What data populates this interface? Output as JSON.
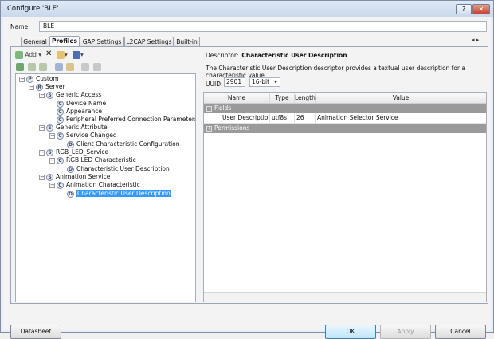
{
  "window": {
    "title": "Configure 'BLE'",
    "help_glyph": "?",
    "close_glyph": "✕"
  },
  "name_field": {
    "label": "Name:",
    "value": "BLE"
  },
  "tabs": [
    {
      "label": "General"
    },
    {
      "label": "Profiles"
    },
    {
      "label": "GAP Settings"
    },
    {
      "label": "L2CAP Settings"
    },
    {
      "label": "Built-in"
    }
  ],
  "tab_scroll": {
    "glyph": "◂ ▸"
  },
  "toolbar": {
    "add_label": "Add",
    "add_icon": "add-icon",
    "delete_glyph": "✕",
    "folder_glyph": "▾",
    "save_glyph": "▾"
  },
  "tree": {
    "custom": "Custom",
    "server": "Server",
    "generic_access": "Generic Access",
    "device_name": "Device Name",
    "appearance": "Appearance",
    "ppcp": "Peripheral Preferred Connection Parameters",
    "generic_attribute": "Generic Attribute",
    "service_changed": "Service Changed",
    "cccd": "Client Characteristic Configuration",
    "rgb_service": "RGB_LED_Service",
    "rgb_char": "RGB LED Characteristic",
    "rgb_cud": "Characteristic User Description",
    "anim_service": "Animation Service",
    "anim_char": "Animation Characteristic",
    "anim_cud": "Characteristic User Description",
    "letters": {
      "P": "P",
      "R": "R",
      "S": "S",
      "C": "C",
      "D": "D"
    }
  },
  "descriptor": {
    "label": "Descriptor:",
    "name": "Characteristic User Description",
    "description": "The Characteristic User Description descriptor provides a textual user description for a characteristic value.",
    "uuid_label": "UUID:",
    "uuid_value": "2901",
    "uuid_size": "16-bit"
  },
  "grid": {
    "headers": {
      "name": "Name",
      "type": "Type",
      "length": "Length",
      "value": "Value"
    },
    "groups": {
      "fields": "Fields",
      "permissions": "Permissions"
    },
    "row": {
      "name": "User Description",
      "type": "utf8s",
      "length": "26",
      "value": "Animation Selector Service"
    }
  },
  "footer": {
    "datasheet": "Datasheet",
    "ok": "OK",
    "apply": "Apply",
    "cancel": "Cancel"
  }
}
